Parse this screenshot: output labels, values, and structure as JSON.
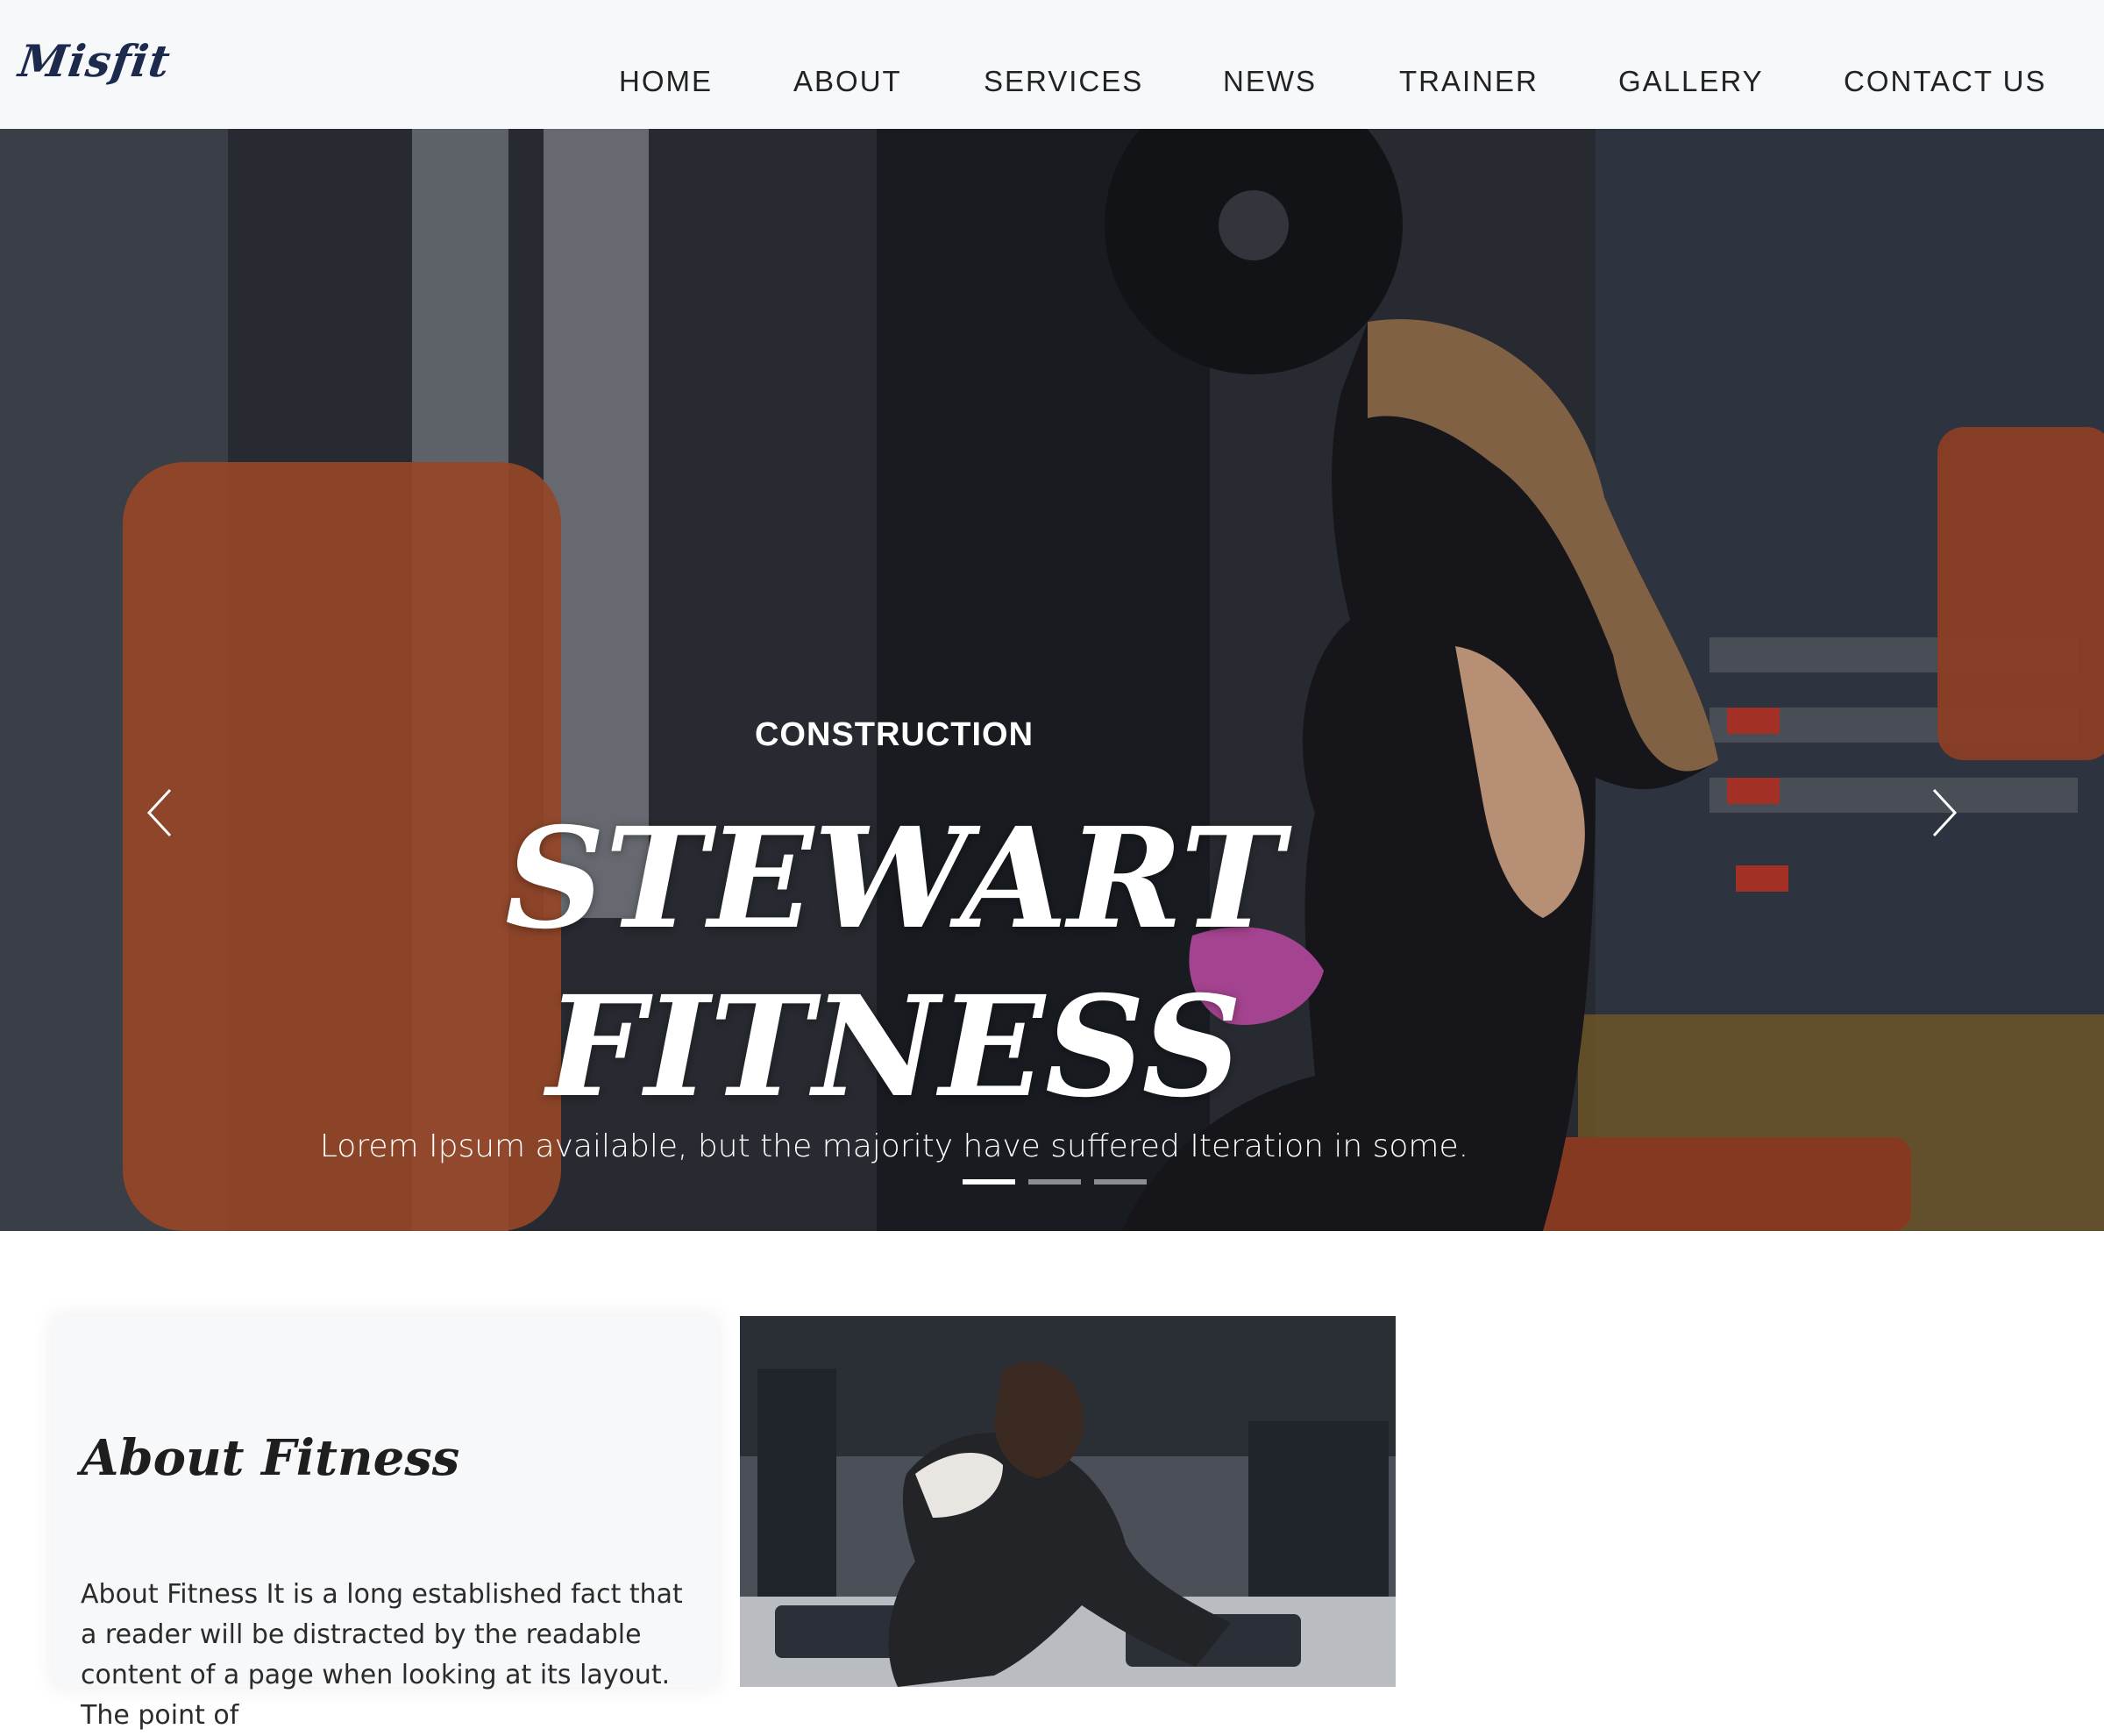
{
  "brand": {
    "logo_text": "Misfit",
    "primary_color": "#1c2a4d"
  },
  "nav": {
    "items": [
      {
        "label": "HOME"
      },
      {
        "label": "ABOUT"
      },
      {
        "label": "SERVICES"
      },
      {
        "label": "NEWS"
      },
      {
        "label": "TRAINER"
      },
      {
        "label": "GALLERY"
      },
      {
        "label": "CONTACT US"
      }
    ]
  },
  "hero": {
    "kicker": "CONSTRUCTION",
    "title_line1": "STEWART",
    "title_line2": "FITNESS",
    "subtitle": "Lorem Ipsum available, but the majority have suffered Iteration in some.",
    "slides_count": 3,
    "active_slide": 1,
    "prev_icon": "chevron-left-icon",
    "next_icon": "chevron-right-icon"
  },
  "about": {
    "title": "About Fitness",
    "text": "About Fitness It is a long established fact that a reader will be distracted by the readable content of a page when looking at its layout. The point of"
  }
}
